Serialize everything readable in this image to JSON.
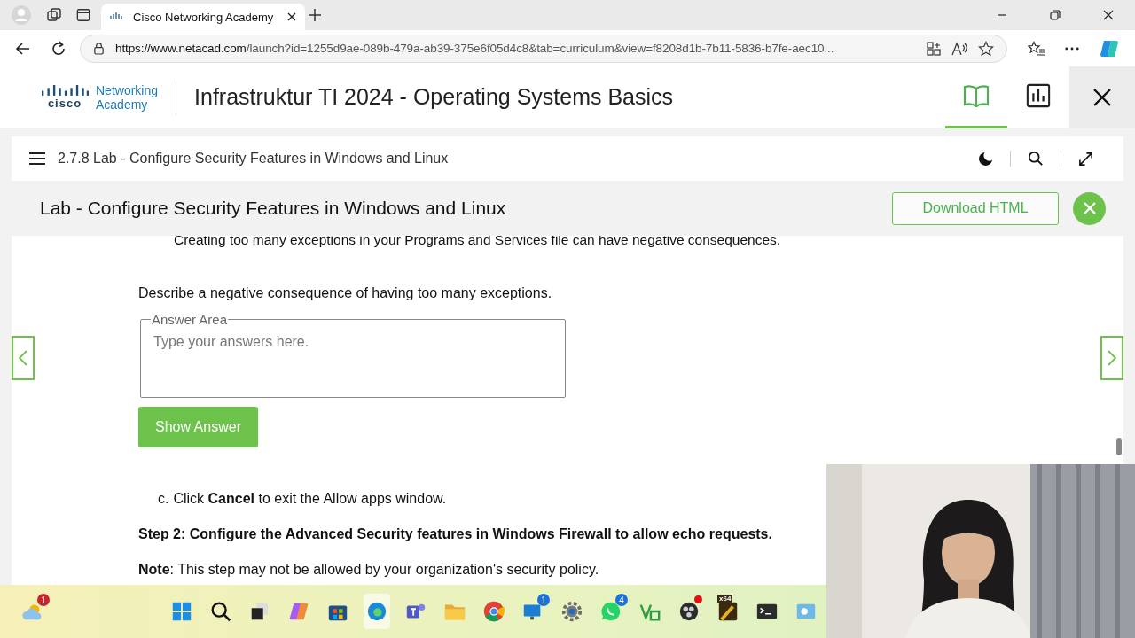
{
  "browser": {
    "tab_title": "Cisco Networking Academy",
    "url_host": "https://www.netacad.com",
    "url_path": "/launch?id=1255d9ae-089b-479a-ab39-375e6f05d4c8&tab=curriculum&view=f8208d1b-7b11-5836-b7fe-aec10..."
  },
  "header": {
    "logo_brand": "cisco",
    "logo_line1": "Networking",
    "logo_line2": "Academy",
    "course_title": "Infrastruktur TI 2024 - Operating Systems Basics",
    "tabs": [
      {
        "kind": "book",
        "selected": true
      },
      {
        "kind": "chart",
        "selected": false
      }
    ]
  },
  "lesson": {
    "title": "2.7.8 Lab - Configure Security Features in Windows and Linux"
  },
  "lab": {
    "title": "Lab - Configure Security Features in Windows and Linux",
    "download": "Download HTML"
  },
  "content": {
    "cut_line": "Creating too many exceptions in your Programs and Services file can have negative consequences.",
    "question": "Describe a negative consequence of having too many exceptions.",
    "answer": {
      "legend": "Answer Area",
      "placeholder": "Type your answers here."
    },
    "show_answer": "Show Answer",
    "step_c": {
      "marker": "c.",
      "text": "Click **Cancel** to exit the Allow apps window."
    },
    "step2": "Step 2: Configure the Advanced Security features in Windows Firewall to allow echo requests.",
    "note": "**Note**: This step may not be allowed by your organization's security policy."
  },
  "taskbar": [
    {
      "kind": "weather",
      "badge": "1",
      "selected": false,
      "dot": false
    },
    {
      "kind": "start",
      "selected": false,
      "dot": false
    },
    {
      "kind": "search",
      "selected": false,
      "dot": false
    },
    {
      "kind": "taskview",
      "selected": false,
      "dot": false
    },
    {
      "kind": "copilot",
      "selected": false,
      "dot": false
    },
    {
      "kind": "store",
      "selected": false,
      "dot": false
    },
    {
      "kind": "edge",
      "selected": true,
      "dot": false
    },
    {
      "kind": "teams",
      "selected": false,
      "dot": false
    },
    {
      "kind": "folder",
      "selected": false,
      "dot": false
    },
    {
      "kind": "chrome",
      "selected": false,
      "dot": false
    },
    {
      "kind": "monitor",
      "badge": "1",
      "selected": false,
      "dot": false
    },
    {
      "kind": "gear",
      "selected": false,
      "dot": false
    },
    {
      "kind": "chat",
      "badge": "4",
      "selected": false,
      "dot": false
    },
    {
      "kind": "vs",
      "selected": false,
      "dot": false
    },
    {
      "kind": "record",
      "selected": false,
      "dot": true
    },
    {
      "kind": "app",
      "label": "x64",
      "selected": false,
      "dot": false
    },
    {
      "kind": "terminal",
      "selected": false,
      "dot": false
    },
    {
      "kind": "widget",
      "selected": false,
      "dot": false
    }
  ]
}
